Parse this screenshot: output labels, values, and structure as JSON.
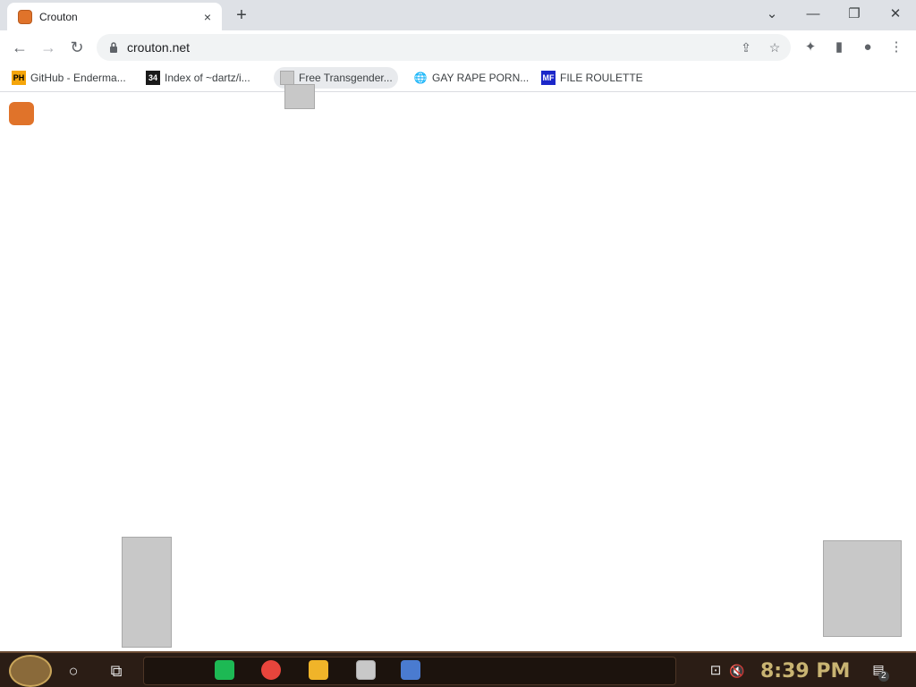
{
  "tab": {
    "title": "Crouton",
    "close_icon": "×"
  },
  "new_tab": {
    "icon": "+"
  },
  "window": {
    "chevron_icon": "⌄",
    "minimize_icon": "—",
    "restore_icon": "❐",
    "close_icon": "✕"
  },
  "nav": {
    "back_icon": "←",
    "forward_icon": "→",
    "reload_icon": "↻"
  },
  "address": {
    "url": "crouton.net",
    "share_icon": "⇪",
    "star_icon": "☆"
  },
  "toolbar": {
    "extensions_icon": "✦",
    "sidepanel_icon": "▮",
    "profile_icon": "●",
    "menu_icon": "⋮"
  },
  "bookmarks": [
    {
      "label": "GitHub - Enderma...",
      "favicon_text": "PH",
      "favicon_bg": "#f5a50a"
    },
    {
      "label": "Index of ~dartz/i...",
      "favicon_text": "34",
      "favicon_bg": "#1a1a1a"
    },
    {
      "label": "Free Transgender...",
      "favicon_text": "",
      "favicon_bg": "#cccccc"
    },
    {
      "label": "GAY RAPE PORN...",
      "favicon_text": "🌐",
      "favicon_bg": "#ffffff"
    },
    {
      "label": "FILE ROULETTE",
      "favicon_text": "MF",
      "favicon_bg": "#1b27c9"
    }
  ],
  "taskbar": {
    "clock": "8:39 PM",
    "search_icon": "○",
    "taskview_icon": "⧉",
    "notification_icon": "▤",
    "notification_count": "2",
    "network_icon": "⊡",
    "volume_icon": "🔇"
  },
  "colors": {
    "accent": "#e0732a",
    "clock": "#c9b472",
    "taskbar": "#2b1d15"
  }
}
